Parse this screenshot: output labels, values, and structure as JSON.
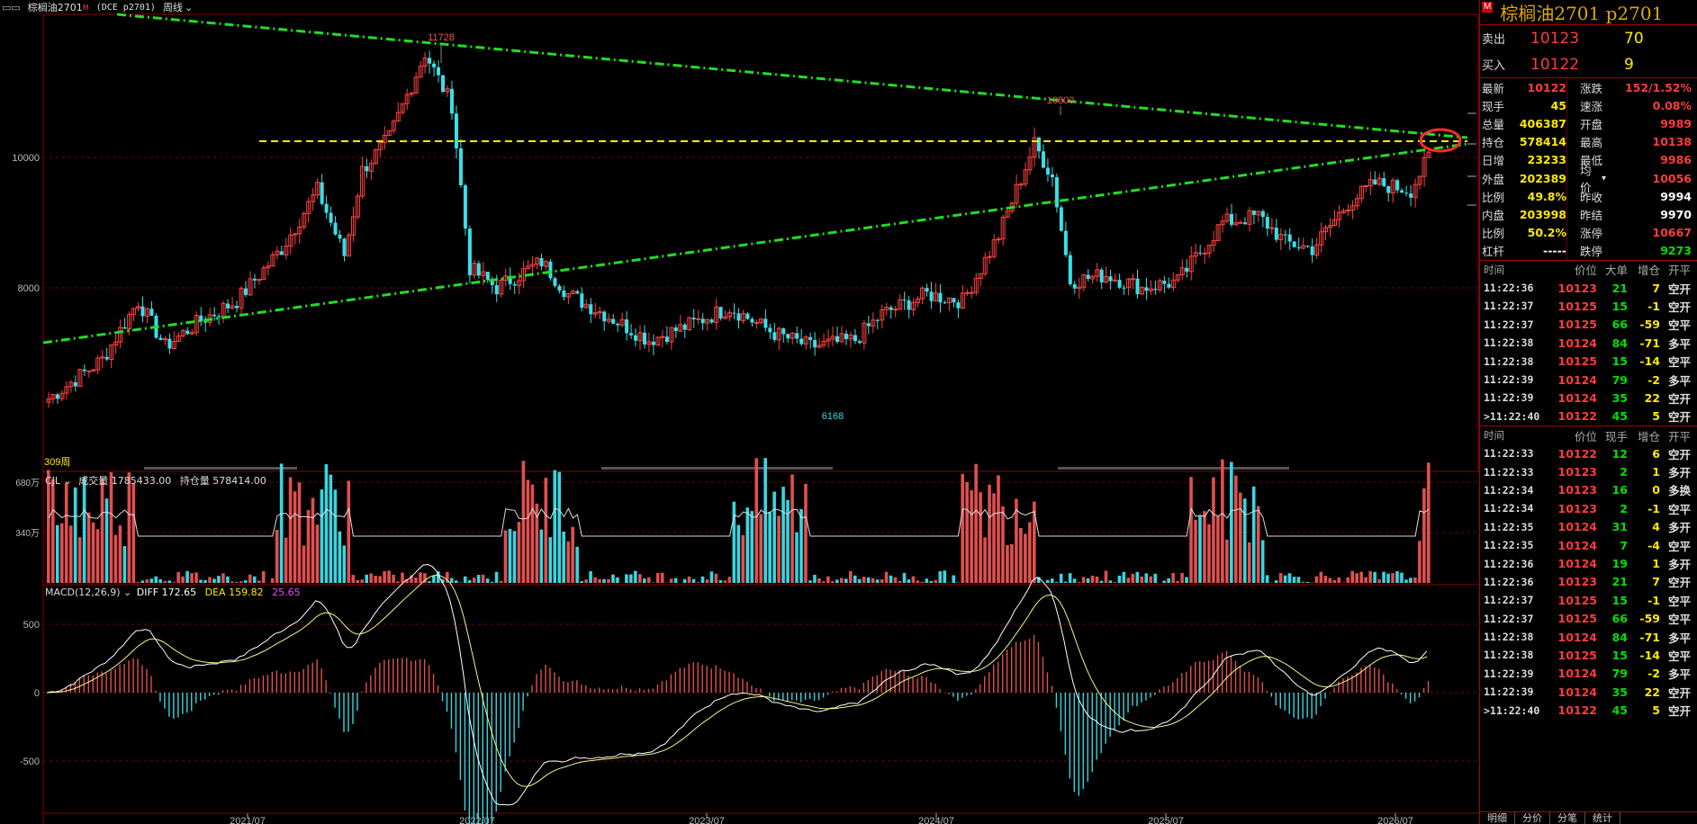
{
  "titlebar": {
    "menu_icon": "grid-menu-icon",
    "instrument": "棕榈油2701",
    "flag": "M",
    "code": "(DCE p2701)",
    "period": "周线"
  },
  "chart": {
    "price_axis": [
      "10000",
      "8000"
    ],
    "x_axis": [
      "2021/07",
      "2022/07",
      "2023/07",
      "2024/07",
      "2025/07",
      "2026/07"
    ],
    "annotations": {
      "high": "11728",
      "high2": "10800",
      "low": "6168"
    },
    "bar_count_label": "309周"
  },
  "volume_panel": {
    "name": "CJL",
    "vol_label": "成交量",
    "vol_value": "1785433.00",
    "oi_label": "持仓量",
    "oi_value": "578414.00",
    "axis": [
      "680万",
      "340万"
    ]
  },
  "macd_panel": {
    "name": "MACD(12,26,9)",
    "diff_label": "DIFF",
    "diff_value": "172.65",
    "dea_label": "DEA",
    "dea_value": "159.82",
    "macd_value": "25.65",
    "axis": [
      "500",
      "0",
      "-500"
    ]
  },
  "quote": {
    "badge": "M",
    "title": "棕榈油2701  p2701",
    "sell_label": "卖出",
    "sell_price": "10123",
    "sell_vol": "70",
    "buy_label": "买入",
    "buy_price": "10122",
    "buy_vol": "9",
    "stats": [
      {
        "k": "最新",
        "v": "10122",
        "vc": "red",
        "k2": "涨跌",
        "v2": "152/1.52%",
        "v2c": "red"
      },
      {
        "k": "现手",
        "v": "45",
        "vc": "yellow",
        "k2": "速涨",
        "v2": "0.08%",
        "v2c": "red"
      },
      {
        "k": "总量",
        "v": "406387",
        "vc": "yellow",
        "k2": "开盘",
        "v2": "9989",
        "v2c": "red"
      },
      {
        "k": "持仓",
        "v": "578414",
        "vc": "yellow",
        "k2": "最高",
        "v2": "10138",
        "v2c": "red"
      },
      {
        "k": "日增",
        "v": "23233",
        "vc": "yellow",
        "k2": "最低",
        "v2": "9986",
        "v2c": "red"
      },
      {
        "k": "外盘",
        "v": "202389",
        "vc": "yellow",
        "k2": "均价",
        "v2": "10056",
        "v2c": "red"
      },
      {
        "k": "比例",
        "v": "49.8%",
        "vc": "yellow",
        "k2": "昨收",
        "v2": "9994",
        "v2c": "white"
      },
      {
        "k": "内盘",
        "v": "203998",
        "vc": "yellow",
        "k2": "昨结",
        "v2": "9970",
        "v2c": "white"
      },
      {
        "k": "比例",
        "v": "50.2%",
        "vc": "yellow",
        "k2": "涨停",
        "v2": "10667",
        "v2c": "red"
      },
      {
        "k": "杠杆",
        "v": "-----",
        "vc": "white",
        "k2": "跌停",
        "v2": "9273",
        "v2c": "green"
      }
    ]
  },
  "ticks1": {
    "headers": [
      "时间",
      "价位",
      "大单",
      "增仓",
      "开平"
    ],
    "rows": [
      [
        "11:22:36",
        "10123",
        "21",
        "7",
        "空开"
      ],
      [
        "11:22:37",
        "10125",
        "15",
        "-1",
        "空开"
      ],
      [
        "11:22:37",
        "10125",
        "66",
        "-59",
        "空平"
      ],
      [
        "11:22:38",
        "10124",
        "84",
        "-71",
        "多平"
      ],
      [
        "11:22:38",
        "10125",
        "15",
        "-14",
        "空平"
      ],
      [
        "11:22:39",
        "10124",
        "79",
        "-2",
        "多平"
      ],
      [
        "11:22:39",
        "10124",
        "35",
        "22",
        "空开"
      ],
      [
        ">11:22:40",
        "10122",
        "45",
        "5",
        "空开"
      ]
    ]
  },
  "ticks2": {
    "headers": [
      "时间",
      "价位",
      "现手",
      "增仓",
      "开平"
    ],
    "rows": [
      [
        "11:22:33",
        "10122",
        "12",
        "6",
        "空开"
      ],
      [
        "11:22:33",
        "10123",
        "2",
        "1",
        "多开"
      ],
      [
        "11:22:34",
        "10123",
        "16",
        "0",
        "多换"
      ],
      [
        "11:22:34",
        "10123",
        "2",
        "-1",
        "空平"
      ],
      [
        "11:22:35",
        "10124",
        "31",
        "4",
        "多开"
      ],
      [
        "11:22:35",
        "10124",
        "7",
        "-4",
        "空平"
      ],
      [
        "11:22:36",
        "10124",
        "19",
        "1",
        "多开"
      ],
      [
        "11:22:36",
        "10123",
        "21",
        "7",
        "空开"
      ],
      [
        "11:22:37",
        "10125",
        "15",
        "-1",
        "空平"
      ],
      [
        "11:22:37",
        "10125",
        "66",
        "-59",
        "空平"
      ],
      [
        "11:22:38",
        "10124",
        "84",
        "-71",
        "多平"
      ],
      [
        "11:22:38",
        "10125",
        "15",
        "-14",
        "空平"
      ],
      [
        "11:22:39",
        "10124",
        "79",
        "-2",
        "多平"
      ],
      [
        "11:22:39",
        "10124",
        "35",
        "22",
        "空开"
      ],
      [
        ">11:22:40",
        "10122",
        "45",
        "5",
        "空开"
      ]
    ]
  },
  "bottom_tabs": [
    "明细",
    "分价",
    "分笔",
    "统计"
  ]
}
